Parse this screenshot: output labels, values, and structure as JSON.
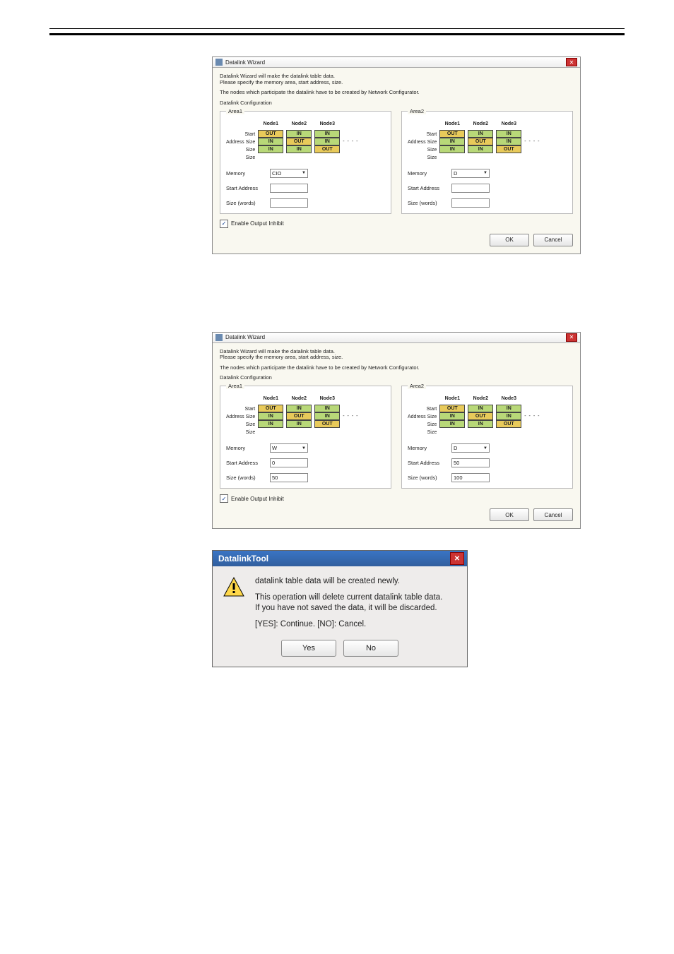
{
  "wizard": {
    "title": "Datalink Wizard",
    "intro_line1": "Datalink Wizard will make the datalink table data.",
    "intro_line2": "Please specify the memory area, start address, size.",
    "nodes_note": "The nodes which participate the datalink have to be created by Network Configurator.",
    "config_label": "Datalink Configuration",
    "area1_label": "Area1",
    "area2_label": "Area2",
    "node_labels": [
      "Node1",
      "Node2",
      "Node3"
    ],
    "row_labels": {
      "r0": "Start",
      "r1": "Address",
      "r2": "Size",
      "r3": "Size",
      "r4": "Size"
    },
    "cells": {
      "out": "OUT",
      "in": "IN"
    },
    "fields": {
      "memory": "Memory",
      "start_address": "Start Address",
      "size_words": "Size (words)"
    },
    "enable_label": "Enable Output Inhibit",
    "ok": "OK",
    "cancel": "Cancel",
    "before": {
      "area1": {
        "memory": "CIO",
        "start": "",
        "size": ""
      },
      "area2": {
        "memory": "D",
        "start": "",
        "size": ""
      },
      "grid1": [
        [
          "OUT",
          "IN",
          "IN"
        ],
        [
          "IN",
          "OUT",
          "IN"
        ],
        [
          "IN",
          "IN",
          "OUT"
        ]
      ],
      "grid2": [
        [
          "OUT",
          "IN",
          "IN"
        ],
        [
          "IN",
          "OUT",
          "IN"
        ],
        [
          "IN",
          "IN",
          "OUT"
        ]
      ]
    },
    "after": {
      "area1": {
        "memory": "W",
        "start": "0",
        "size": "50"
      },
      "area2": {
        "memory": "D",
        "start": "50",
        "size": "100"
      },
      "grid1": [
        [
          "OUT",
          "IN",
          "IN"
        ],
        [
          "IN",
          "OUT",
          "IN"
        ],
        [
          "IN",
          "IN",
          "OUT"
        ]
      ],
      "grid2": [
        [
          "OUT",
          "IN",
          "IN"
        ],
        [
          "IN",
          "OUT",
          "IN"
        ],
        [
          "IN",
          "IN",
          "OUT"
        ]
      ]
    }
  },
  "confirm": {
    "title": "DatalinkTool",
    "line1": "datalink table data will be created newly.",
    "line2": "This operation will delete current datalink table data.",
    "line3": "If you have not saved the data, it will be discarded.",
    "line4": "[YES]: Continue. [NO]: Cancel.",
    "yes": "Yes",
    "no": "No"
  }
}
